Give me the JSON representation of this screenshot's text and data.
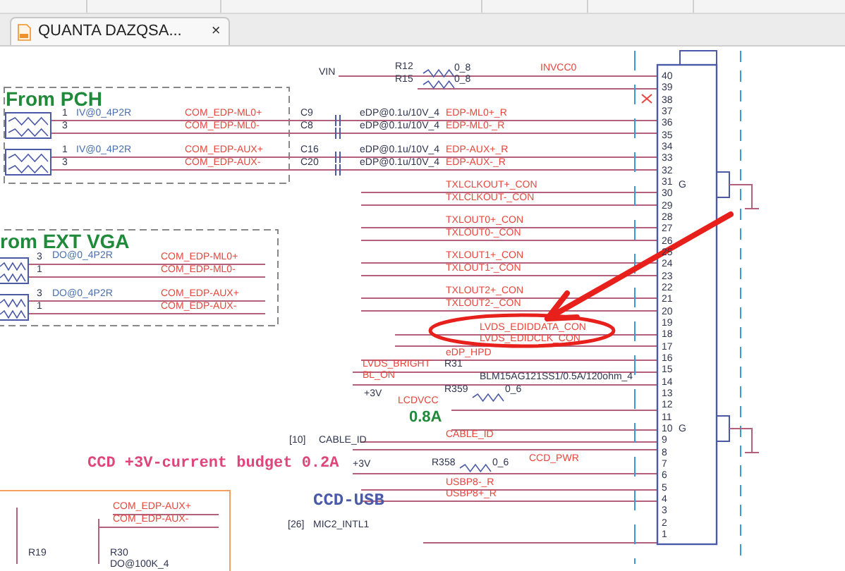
{
  "tab": {
    "title": "QUANTA  DAZQSA...",
    "selected": true,
    "close": "×"
  },
  "schematic": {
    "labels": [
      {
        "text": "VIN",
        "kind": "power"
      },
      {
        "text": "R12",
        "kind": "part"
      },
      {
        "text": "R15",
        "kind": "part"
      },
      {
        "text": "0_8",
        "kind": "part"
      },
      {
        "text": "0_8",
        "kind": "part"
      },
      {
        "text": "INVCC0",
        "kind": "net"
      },
      {
        "text": "From PCH",
        "kind": "heading"
      },
      {
        "text": "1",
        "kind": "pin"
      },
      {
        "text": "IV@0_4P2R",
        "kind": "ref"
      },
      {
        "text": "COM_EDP-ML0+",
        "kind": "net"
      },
      {
        "text": "C9",
        "kind": "part"
      },
      {
        "text": "eDP@0.1u/10V_4",
        "kind": "part"
      },
      {
        "text": "EDP-ML0+_R",
        "kind": "net"
      },
      {
        "text": "3",
        "kind": "pin"
      },
      {
        "text": "COM_EDP-ML0-",
        "kind": "net"
      },
      {
        "text": "C8",
        "kind": "part"
      },
      {
        "text": "eDP@0.1u/10V_4",
        "kind": "part"
      },
      {
        "text": "EDP-ML0-_R",
        "kind": "net"
      },
      {
        "text": "1",
        "kind": "pin"
      },
      {
        "text": "IV@0_4P2R",
        "kind": "ref"
      },
      {
        "text": "COM_EDP-AUX+",
        "kind": "net"
      },
      {
        "text": "C16",
        "kind": "part"
      },
      {
        "text": "eDP@0.1u/10V_4",
        "kind": "part"
      },
      {
        "text": "EDP-AUX+_R",
        "kind": "net"
      },
      {
        "text": "3",
        "kind": "pin"
      },
      {
        "text": "COM_EDP-AUX-",
        "kind": "net"
      },
      {
        "text": "C20",
        "kind": "part"
      },
      {
        "text": "eDP@0.1u/10V_4",
        "kind": "part"
      },
      {
        "text": "EDP-AUX-_R",
        "kind": "net"
      },
      {
        "text": "TXLCLKOUT+_CON",
        "kind": "net"
      },
      {
        "text": "TXLCLKOUT-_CON",
        "kind": "net"
      },
      {
        "text": "TXLOUT0+_CON",
        "kind": "net"
      },
      {
        "text": "TXLOUT0-_CON",
        "kind": "net"
      },
      {
        "text": "rom EXT VGA",
        "kind": "heading"
      },
      {
        "text": "3",
        "kind": "pin"
      },
      {
        "text": "DO@0_4P2R",
        "kind": "ref"
      },
      {
        "text": "COM_EDP-ML0+",
        "kind": "net"
      },
      {
        "text": "1",
        "kind": "pin"
      },
      {
        "text": "COM_EDP-ML0-",
        "kind": "net"
      },
      {
        "text": "TXLOUT1+_CON",
        "kind": "net"
      },
      {
        "text": "TXLOUT1-_CON",
        "kind": "net"
      },
      {
        "text": "3",
        "kind": "pin"
      },
      {
        "text": "DO@0_4P2R",
        "kind": "ref"
      },
      {
        "text": "COM_EDP-AUX+",
        "kind": "net"
      },
      {
        "text": "1",
        "kind": "pin"
      },
      {
        "text": "COM_EDP-AUX-",
        "kind": "net"
      },
      {
        "text": "TXLOUT2+_CON",
        "kind": "net"
      },
      {
        "text": "TXLOUT2-_CON",
        "kind": "net"
      },
      {
        "text": "LVDS_EDIDDATA_CON",
        "kind": "net"
      },
      {
        "text": "LVDS_EDIDCLK_CON",
        "kind": "net"
      },
      {
        "text": "eDP_HPD",
        "kind": "net"
      },
      {
        "text": "LVDS_BRIGHT",
        "kind": "net"
      },
      {
        "text": "R31",
        "kind": "part"
      },
      {
        "text": "BL_ON",
        "kind": "net"
      },
      {
        "text": "BLM15AG121SS1/0.5A/120ohm_4",
        "kind": "part"
      },
      {
        "text": "+3V",
        "kind": "power"
      },
      {
        "text": "R359",
        "kind": "part"
      },
      {
        "text": "0_6",
        "kind": "part"
      },
      {
        "text": "LCDVCC",
        "kind": "net"
      },
      {
        "text": "0.8A",
        "kind": "current"
      },
      {
        "text": "[10]",
        "kind": "power"
      },
      {
        "text": "CABLE_ID",
        "kind": "power"
      },
      {
        "text": "CABLE_ID",
        "kind": "net"
      },
      {
        "text": "CCD +3V-current budget 0.2A",
        "kind": "note"
      },
      {
        "text": "+3V",
        "kind": "power"
      },
      {
        "text": "R358",
        "kind": "part"
      },
      {
        "text": "0_6",
        "kind": "part"
      },
      {
        "text": "CCD_PWR",
        "kind": "net"
      },
      {
        "text": "USBP8-_R",
        "kind": "net"
      },
      {
        "text": "USBP8+_R",
        "kind": "net"
      },
      {
        "text": "CCD-USB",
        "kind": "block"
      },
      {
        "text": "COM_EDP-AUX+",
        "kind": "net"
      },
      {
        "text": "COM_EDP-AUX-",
        "kind": "net"
      },
      {
        "text": "[26]",
        "kind": "power"
      },
      {
        "text": "MIC2_INTL1",
        "kind": "power"
      },
      {
        "text": "R19",
        "kind": "part"
      },
      {
        "text": "R30",
        "kind": "part"
      },
      {
        "text": "DO@100K_4",
        "kind": "part"
      },
      {
        "text": "G",
        "kind": "part"
      },
      {
        "text": "G",
        "kind": "part"
      }
    ],
    "connector_pins": [
      "40",
      "39",
      "38",
      "37",
      "36",
      "35",
      "34",
      "33",
      "32",
      "31",
      "30",
      "29",
      "28",
      "27",
      "26",
      "25",
      "24",
      "23",
      "22",
      "21",
      "20",
      "19",
      "18",
      "17",
      "16",
      "15",
      "14",
      "13",
      "12",
      "11",
      "10",
      "9",
      "8",
      "7",
      "6",
      "5",
      "4",
      "3",
      "2",
      "1"
    ]
  }
}
